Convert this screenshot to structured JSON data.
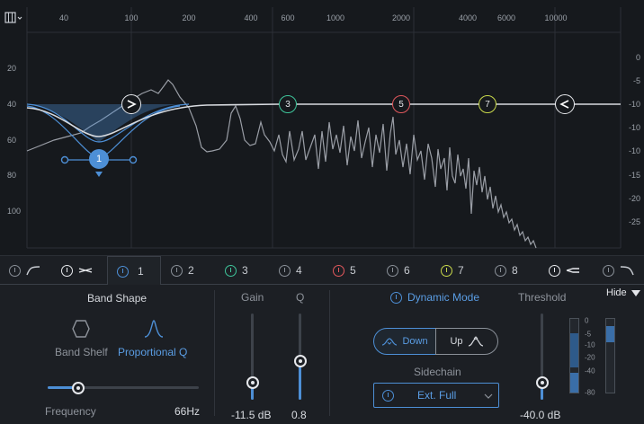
{
  "graph": {
    "freq_labels": [
      "40",
      "100",
      "200",
      "400",
      "600",
      "1000",
      "2000",
      "4000",
      "6000",
      "10000"
    ],
    "db_left_labels": [
      "20",
      "40",
      "60",
      "80",
      "100"
    ],
    "db_right_labels": [
      "0",
      "-5",
      "-10",
      "-15",
      "-20",
      "-25"
    ],
    "nodes": [
      {
        "label": "1",
        "kind": "selected",
        "color": "#4d8fd6"
      },
      {
        "label": "3",
        "kind": "ring",
        "color": "#3ec49a"
      },
      {
        "label": "5",
        "kind": "ring",
        "color": "#e0575c"
      },
      {
        "label": "7",
        "kind": "ring",
        "color": "#c8d84a"
      }
    ],
    "curve_color": "#d8dbe0",
    "fill_color": "#4d8fd6"
  },
  "bands": {
    "tabs": [
      {
        "label": "",
        "icon": "low-cut-icon",
        "color": "#8a9098"
      },
      {
        "label": "",
        "icon": "low-shelf-icon",
        "color": "#e8eaee"
      },
      {
        "label": "1",
        "icon": "",
        "color": "#4d8fd6",
        "active": true
      },
      {
        "label": "2",
        "icon": "",
        "color": "#8a9098"
      },
      {
        "label": "3",
        "icon": "",
        "color": "#3ec49a"
      },
      {
        "label": "4",
        "icon": "",
        "color": "#8a9098"
      },
      {
        "label": "5",
        "icon": "",
        "color": "#e0575c"
      },
      {
        "label": "6",
        "icon": "",
        "color": "#8a9098"
      },
      {
        "label": "7",
        "icon": "",
        "color": "#c8d84a"
      },
      {
        "label": "8",
        "icon": "",
        "color": "#8a9098"
      },
      {
        "label": "",
        "icon": "high-shelf-icon",
        "color": "#e8eaee"
      },
      {
        "label": "",
        "icon": "high-cut-icon",
        "color": "#8a9098"
      }
    ]
  },
  "panel": {
    "band_shape_title": "Band Shape",
    "band_shelf_label": "Band Shelf",
    "proportional_q_label": "Proportional Q",
    "frequency_label": "Frequency",
    "frequency_value": "66Hz",
    "frequency_position": 0.2,
    "gain_label": "Gain",
    "gain_value": "-11.5 dB",
    "gain_level": 0.2,
    "q_label": "Q",
    "q_value": "0.8",
    "q_level": 0.45,
    "dynamic_mode_label": "Dynamic Mode",
    "down_label": "Down",
    "up_label": "Up",
    "sidechain_label": "Sidechain",
    "sidechain_value": "Ext. Full",
    "threshold_label": "Threshold",
    "threshold_value": "-40.0 dB",
    "threshold_level": 0.2,
    "hide_label": "Hide",
    "meter_scale": [
      "0",
      "-5",
      "-10",
      "-20",
      "-40",
      "-80"
    ],
    "accent_color": "#4d8fd6"
  }
}
